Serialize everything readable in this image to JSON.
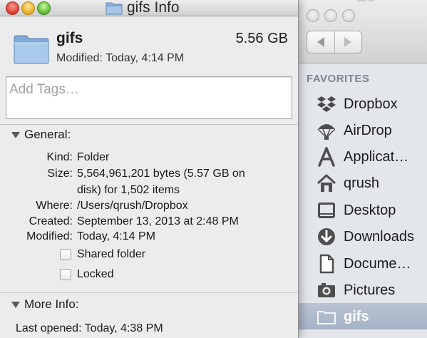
{
  "finder": {
    "ghost_title": "ars",
    "sidebar_heading": "FAVORITES",
    "items": [
      {
        "label": "Dropbox",
        "icon": "dropbox-icon"
      },
      {
        "label": "AirDrop",
        "icon": "airdrop-icon"
      },
      {
        "label": "Applicat…",
        "icon": "applications-icon"
      },
      {
        "label": "qrush",
        "icon": "home-icon"
      },
      {
        "label": "Desktop",
        "icon": "desktop-icon"
      },
      {
        "label": "Downloads",
        "icon": "downloads-icon"
      },
      {
        "label": "Docume…",
        "icon": "documents-icon"
      },
      {
        "label": "Pictures",
        "icon": "pictures-icon"
      },
      {
        "label": "gifs",
        "icon": "folder-icon",
        "selected": true
      }
    ]
  },
  "info": {
    "window_title": "gifs Info",
    "name": "gifs",
    "size": "5.56 GB",
    "modified": "Modified: Today, 4:14 PM",
    "tags_placeholder": "Add Tags…",
    "general": {
      "heading": "General:",
      "kind_label": "Kind:",
      "kind": "Folder",
      "size_label": "Size:",
      "size_line1": "5,564,961,201 bytes (5.57 GB on",
      "size_line2": "disk) for 1,502 items",
      "where_label": "Where:",
      "where": "/Users/qrush/Dropbox",
      "created_label": "Created:",
      "created": "September 13, 2013 at 2:48 PM",
      "modified_label": "Modified:",
      "modified": "Today, 4:14 PM",
      "shared_folder": "Shared folder",
      "shared_folder_checked": false,
      "locked": "Locked",
      "locked_checked": false
    },
    "more_info": {
      "heading": "More Info:",
      "last_opened": "Last opened: Today, 4:38 PM"
    }
  },
  "colors": {
    "selection": "#a6b2c6",
    "folder_blue": "#8fb6de",
    "sidebar_bg": "#e3e6eb"
  }
}
